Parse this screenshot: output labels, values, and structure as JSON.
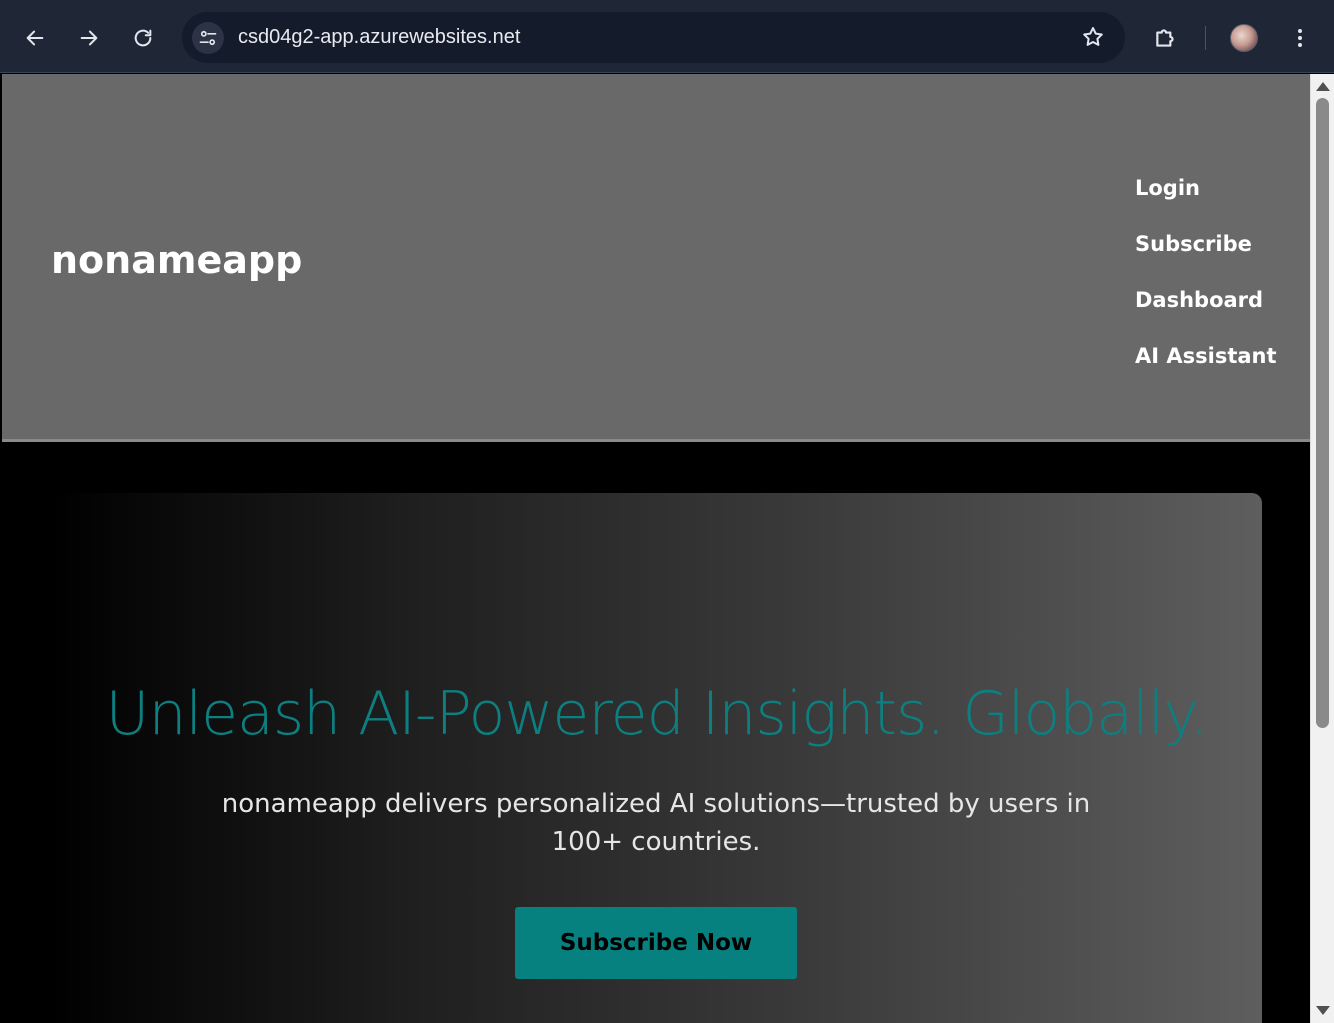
{
  "browser": {
    "url": "csd04g2-app.azurewebsites.net",
    "icons": {
      "back": "arrow-left-icon",
      "forward": "arrow-right-icon",
      "reload": "reload-icon",
      "site_info": "tune-icon",
      "bookmark": "star-icon",
      "extensions": "puzzle-icon",
      "profile": "avatar",
      "menu": "kebab-menu-icon"
    }
  },
  "site": {
    "brand": "nonameapp",
    "nav": [
      "Login",
      "Subscribe",
      "Dashboard",
      "AI Assistant"
    ],
    "hero": {
      "title": "Unleash AI-Powered Insights. Globally.",
      "subtitle": "nonameapp delivers personalized AI solutions—trusted by users in 100+ countries.",
      "cta": "Subscribe Now"
    }
  },
  "colors": {
    "header_bg": "#696969",
    "accent": "#078080",
    "title": "#0e7f80",
    "chrome_bg": "#1f2636"
  }
}
